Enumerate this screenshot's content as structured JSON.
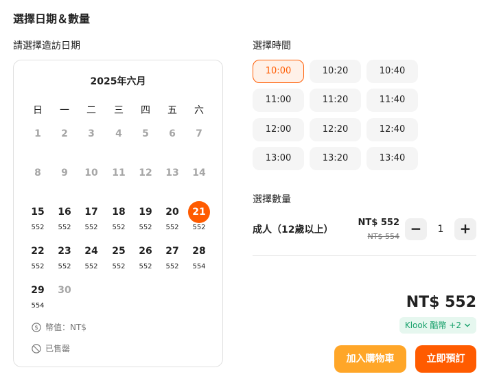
{
  "page": {
    "title": "選擇日期＆數量"
  },
  "calendar": {
    "label": "請選擇造訪日期",
    "month_title": "2025年六月",
    "weekdays": [
      "日",
      "一",
      "二",
      "三",
      "四",
      "五",
      "六"
    ],
    "days": [
      {
        "day": "1",
        "price": "",
        "available": false,
        "selected": false
      },
      {
        "day": "2",
        "price": "",
        "available": false,
        "selected": false
      },
      {
        "day": "3",
        "price": "",
        "available": false,
        "selected": false
      },
      {
        "day": "4",
        "price": "",
        "available": false,
        "selected": false
      },
      {
        "day": "5",
        "price": "",
        "available": false,
        "selected": false
      },
      {
        "day": "6",
        "price": "",
        "available": false,
        "selected": false
      },
      {
        "day": "7",
        "price": "",
        "available": false,
        "selected": false
      },
      {
        "day": "8",
        "price": "",
        "available": false,
        "selected": false
      },
      {
        "day": "9",
        "price": "",
        "available": false,
        "selected": false
      },
      {
        "day": "10",
        "price": "",
        "available": false,
        "selected": false
      },
      {
        "day": "11",
        "price": "",
        "available": false,
        "selected": false
      },
      {
        "day": "12",
        "price": "",
        "available": false,
        "selected": false
      },
      {
        "day": "13",
        "price": "",
        "available": false,
        "selected": false
      },
      {
        "day": "14",
        "price": "",
        "available": false,
        "selected": false
      },
      {
        "day": "15",
        "price": "552",
        "available": true,
        "selected": false
      },
      {
        "day": "16",
        "price": "552",
        "available": true,
        "selected": false
      },
      {
        "day": "17",
        "price": "552",
        "available": true,
        "selected": false
      },
      {
        "day": "18",
        "price": "552",
        "available": true,
        "selected": false
      },
      {
        "day": "19",
        "price": "552",
        "available": true,
        "selected": false
      },
      {
        "day": "20",
        "price": "552",
        "available": true,
        "selected": false
      },
      {
        "day": "21",
        "price": "552",
        "available": true,
        "selected": true
      },
      {
        "day": "22",
        "price": "552",
        "available": true,
        "selected": false
      },
      {
        "day": "23",
        "price": "552",
        "available": true,
        "selected": false
      },
      {
        "day": "24",
        "price": "552",
        "available": true,
        "selected": false
      },
      {
        "day": "25",
        "price": "552",
        "available": true,
        "selected": false
      },
      {
        "day": "26",
        "price": "552",
        "available": true,
        "selected": false
      },
      {
        "day": "27",
        "price": "552",
        "available": true,
        "selected": false
      },
      {
        "day": "28",
        "price": "554",
        "available": true,
        "selected": false
      },
      {
        "day": "29",
        "price": "554",
        "available": true,
        "selected": false
      },
      {
        "day": "30",
        "price": "",
        "available": false,
        "selected": false
      }
    ],
    "legend_currency": "幣值：NT$",
    "legend_soldout": "已售罄",
    "legend_currency_icon": "dollar-circle-icon",
    "legend_soldout_icon": "prohibited-icon"
  },
  "time": {
    "label": "選擇時間",
    "slots": [
      "10:00",
      "10:20",
      "10:40",
      "11:00",
      "11:20",
      "11:40",
      "12:00",
      "12:20",
      "12:40",
      "13:00",
      "13:20",
      "13:40"
    ],
    "selected": "10:00"
  },
  "quantity": {
    "label": "選擇數量",
    "type_label": "成人（12歲以上）",
    "price": "NT$ 552",
    "original_price": "NT$ 554",
    "value": "1",
    "minus": "−",
    "plus": "+"
  },
  "summary": {
    "total": "NT$ 552",
    "coins": "Klook 酷幣 +2"
  },
  "actions": {
    "add_to_cart": "加入購物車",
    "book_now": "立即預訂"
  },
  "colors": {
    "accent": "#ff5b00",
    "cart_button": "#ffa628",
    "coins_text": "#16a06a",
    "coins_bg": "#e6f7ef"
  }
}
